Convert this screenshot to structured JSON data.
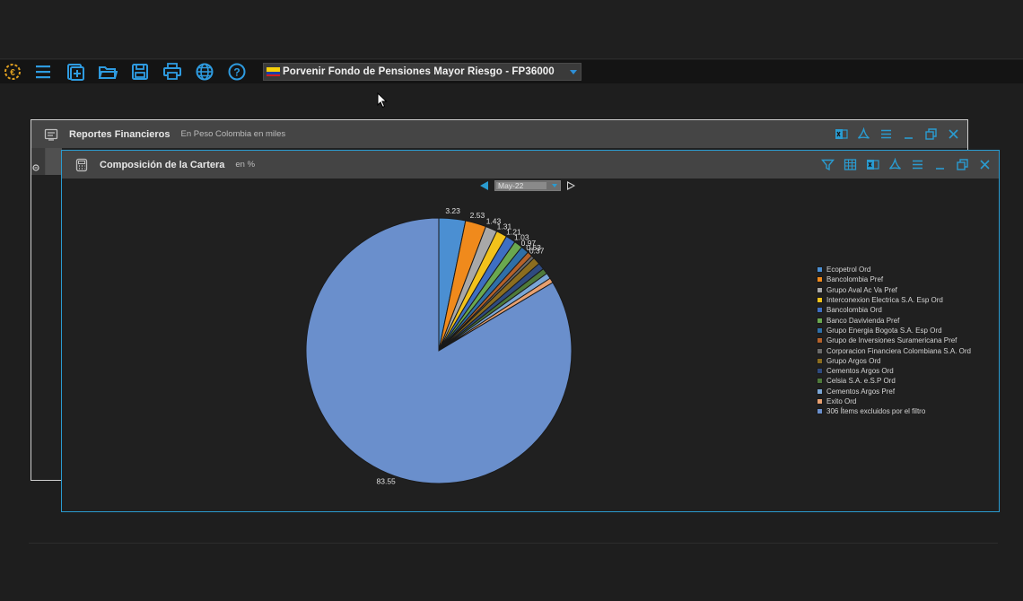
{
  "toolbar": {
    "icons": [
      "app-logo-icon",
      "menu-icon",
      "new-document-icon",
      "open-folder-icon",
      "save-icon",
      "print-icon",
      "globe-icon",
      "help-icon"
    ],
    "portfolio": "Porvenir Fondo de Pensiones Mayor Riesgo - FP36000"
  },
  "outer_window": {
    "title": "Reportes Financieros",
    "subtitle": "En Peso Colombia en miles"
  },
  "inner_window": {
    "title": "Composición de la Cartera",
    "subtitle": "en %",
    "period": "May-22"
  },
  "colors": {
    "accent": "#2a9bd0"
  },
  "chart_data": {
    "type": "pie",
    "values": [
      3.23,
      2.53,
      1.43,
      1.31,
      1.21,
      1.03,
      0.97,
      0.63,
      0.37,
      0.9,
      0.8,
      0.7,
      0.7,
      0.6,
      83.55
    ],
    "data_labels": [
      "3.23",
      "2.53",
      "1.43",
      "1.31",
      "1.21",
      "1.03",
      "0.97",
      "0.63",
      "0.37",
      "",
      "",
      "",
      "",
      "",
      "83.55"
    ],
    "series": [
      {
        "name": "Ecopetrol Ord",
        "color": "#4b8fd2"
      },
      {
        "name": "Bancolombia Pref",
        "color": "#f08a1c"
      },
      {
        "name": "Grupo Aval Ac Va Pref",
        "color": "#a8a8a8"
      },
      {
        "name": "Interconexion Electrica S.A. Esp Ord",
        "color": "#f2c21b"
      },
      {
        "name": "Bancolombia Ord",
        "color": "#3e6fc2"
      },
      {
        "name": "Banco Davivienda Pref",
        "color": "#6aa84f"
      },
      {
        "name": "Grupo Energia Bogota S.A. Esp Ord",
        "color": "#2f6fa8"
      },
      {
        "name": "Grupo de Inversiones Suramericana Pref",
        "color": "#b5622a"
      },
      {
        "name": "Corporacion Financiera Colombiana S.A. Ord",
        "color": "#6b6b6b"
      },
      {
        "name": "Grupo Argos Ord",
        "color": "#8c6d1f"
      },
      {
        "name": "Cementos Argos Ord",
        "color": "#2f4b80"
      },
      {
        "name": "Celsia S.A. e.S.P Ord",
        "color": "#4e7a3a"
      },
      {
        "name": "Cementos Argos Pref",
        "color": "#7aa6d6"
      },
      {
        "name": "Exito Ord",
        "color": "#e8a070"
      },
      {
        "name": "306 Ítems excluidos por el filtro",
        "color": "#6a8fcc"
      }
    ],
    "legend": "right"
  }
}
